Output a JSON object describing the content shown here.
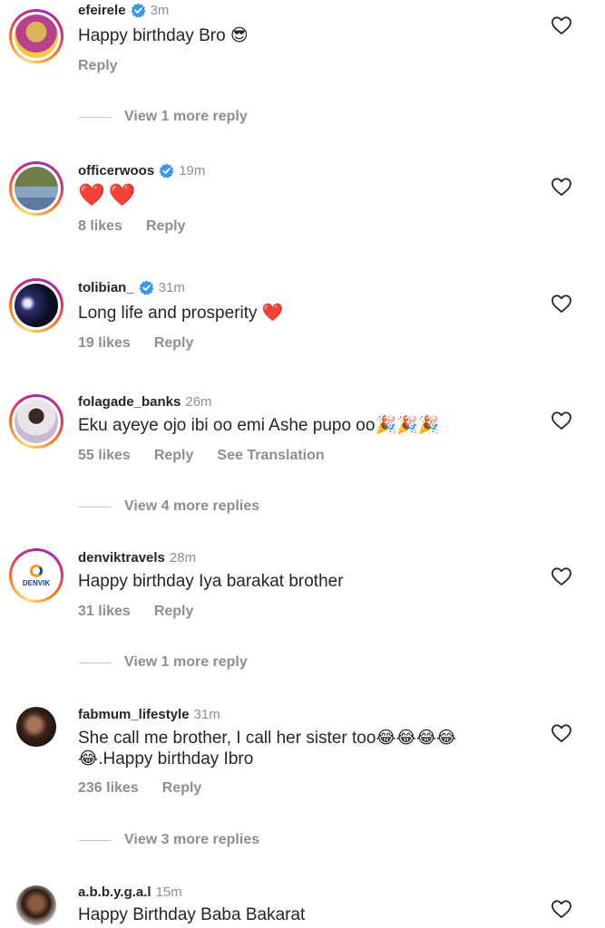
{
  "comments": [
    {
      "username": "efeirele",
      "time": "3m",
      "text": "Happy birthday Bro 😎",
      "likes": "",
      "reply": "Reply",
      "verified": true
    },
    {
      "username": "officerwoos",
      "time": "19m",
      "text": "❤️❤️",
      "likes": "8 likes",
      "reply": "Reply",
      "verified": true
    },
    {
      "username": "tolibian_",
      "time": "31m",
      "text": "Long life and prosperity ❤️",
      "likes": "19 likes",
      "reply": "Reply",
      "verified": true
    },
    {
      "username": "folagade_banks",
      "time": "26m",
      "text": "Eku ayeye ojo ibi oo emi Ashe pupo oo🎉🎉🎉",
      "likes": "55 likes",
      "reply": "Reply",
      "translate": "See Translation",
      "verified": false
    },
    {
      "username": "denviktravels",
      "time": "28m",
      "text": "Happy birthday Iya barakat brother",
      "likes": "31 likes",
      "reply": "Reply",
      "verified": false
    },
    {
      "username": "fabmum_lifestyle",
      "time": "31m",
      "text_line1": "She call me brother, I call her sister too😂😂😂😂",
      "text_line2": "😂.Happy birthday Ibro",
      "likes": "236 likes",
      "reply": "Reply",
      "verified": false
    },
    {
      "username": "a.b.b.y.g.a.l",
      "time": "15m",
      "text": "Happy Birthday Baba Bakarat",
      "verified": false
    }
  ],
  "view_more": {
    "first": "View 1 more reply",
    "second": "View 4 more replies",
    "third": "View 1 more reply",
    "fourth": "View 3 more replies"
  },
  "denvik_logo_text": "DENVIK",
  "colors": {
    "verified": "#3897f0",
    "heart": "#e0245e",
    "secondary_text": "#8e8e8e"
  },
  "icons": [
    "verified-badge-icon",
    "heart-outline-icon"
  ]
}
